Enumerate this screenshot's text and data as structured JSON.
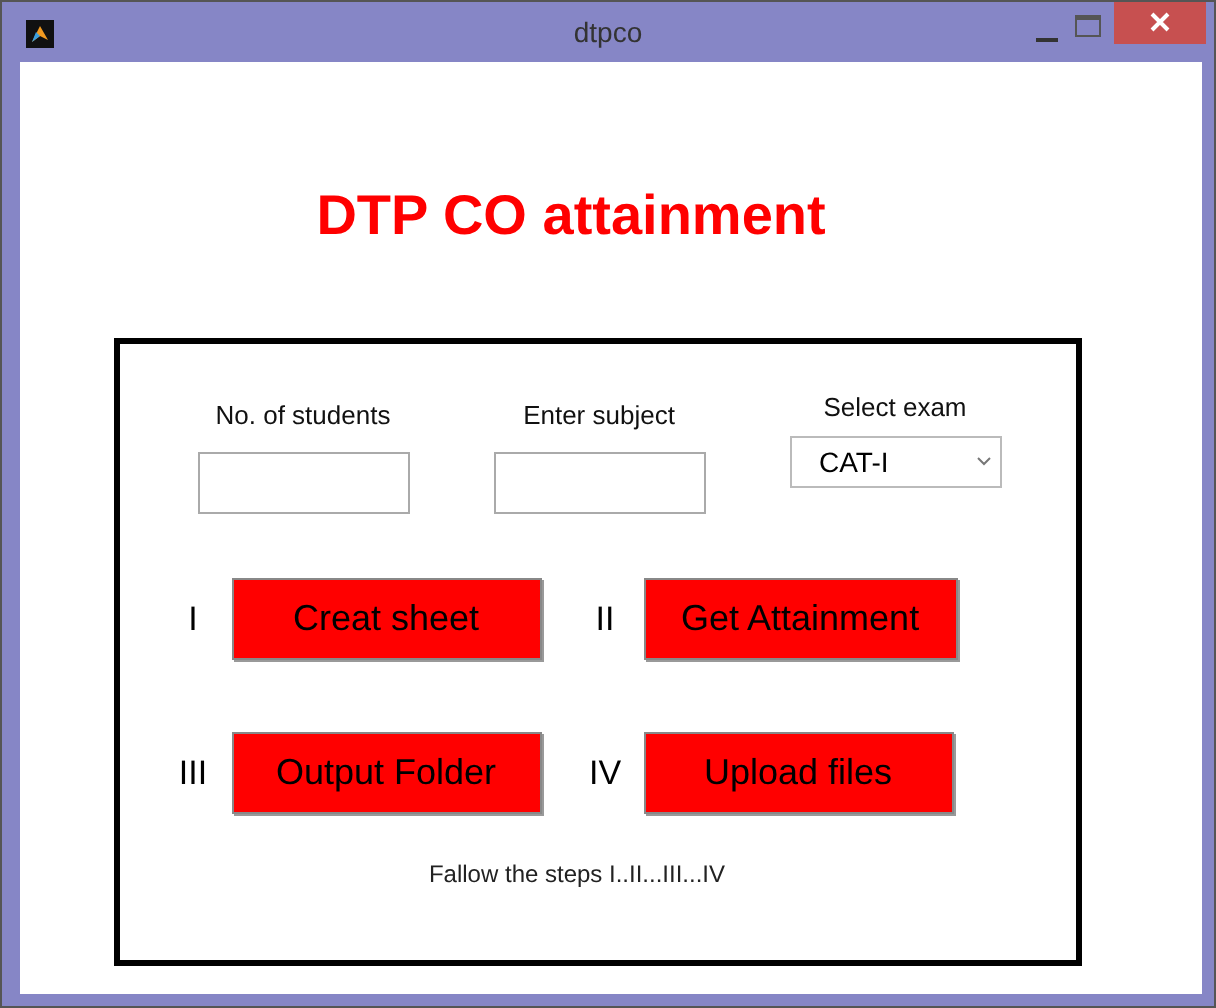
{
  "window": {
    "title": "dtpco"
  },
  "heading": "DTP CO attainment",
  "fields": [
    {
      "kind": "text",
      "label": "No. of students"
    },
    {
      "kind": "text",
      "label": "Enter subject"
    },
    {
      "kind": "select",
      "label": "Select exam",
      "value": "CAT-I"
    }
  ],
  "steps": [
    {
      "numeral": "I",
      "label": "Creat sheet"
    },
    {
      "numeral": "II",
      "label": "Get Attainment"
    },
    {
      "numeral": "III",
      "label": "Output Folder"
    },
    {
      "numeral": "IV",
      "label": "Upload files"
    }
  ],
  "hint": "Fallow the steps I..II...III...IV"
}
